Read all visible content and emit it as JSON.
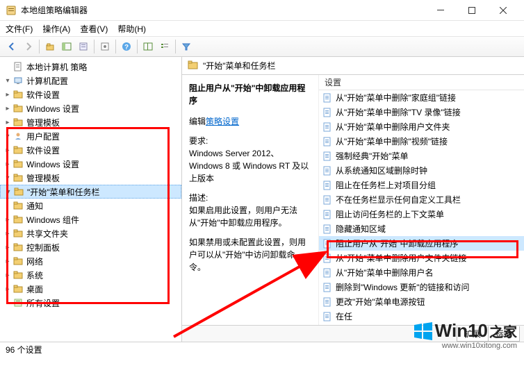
{
  "title": "本地组策略编辑器",
  "menu": {
    "file": "文件(F)",
    "action": "操作(A)",
    "view": "查看(V)",
    "help": "帮助(H)"
  },
  "tree": {
    "root": "本地计算机 策略",
    "computer": "计算机配置",
    "c_soft": "软件设置",
    "c_win": "Windows 设置",
    "c_tpl": "管理模板",
    "user": "用户配置",
    "u_soft": "软件设置",
    "u_win": "Windows 设置",
    "u_tpl": "管理模板",
    "start": "\"开始\"菜单和任务栏",
    "notify": "通知",
    "wincomp": "Windows 组件",
    "share": "共享文件夹",
    "ctrl": "控制面板",
    "net": "网络",
    "sys": "系统",
    "desk": "桌面",
    "all": "所有设置"
  },
  "path": "\"开始\"菜单和任务栏",
  "desc": {
    "title": "阻止用户从\"开始\"中卸载应用程序",
    "edit_label": "编辑",
    "edit_link": "策略设置",
    "req_label": "要求:",
    "req": "Windows Server 2012、Windows 8 或 Windows RT 及以上版本",
    "d_label": "描述:",
    "d1": "如果启用此设置，则用户无法从\"开始\"中卸载应用程序。",
    "d2": "如果禁用或未配置此设置，则用户可以从\"开始\"中访问卸载命令。"
  },
  "list_hdr": "设置",
  "list": [
    "从\"开始\"菜单中删除\"家庭组\"链接",
    "从\"开始\"菜单中删除\"TV 录像\"链接",
    "从\"开始\"菜单中删除用户文件夹",
    "从\"开始\"菜单中删除\"视频\"链接",
    "强制经典\"开始\"菜单",
    "从系统通知区域删除时钟",
    "阻止在任务栏上对项目分组",
    "不在任务栏显示任何自定义工具栏",
    "阻止访问任务栏的上下文菜单",
    "隐藏通知区域",
    "阻止用户从\"开始\"中卸载应用程序",
    "从\"开始\"菜单中删除用户文件夹链接",
    "从\"开始\"菜单中删除用户名",
    "删除到\"Windows 更新\"的链接和访问",
    "更改\"开始\"菜单电源按钮",
    "在任"
  ],
  "tabs": {
    "ext": "扩展",
    "std": "标准"
  },
  "status": "96 个设置",
  "watermark": {
    "brand": "Win10",
    "suffix": "之家",
    "url": "www.win10xitong.com"
  }
}
